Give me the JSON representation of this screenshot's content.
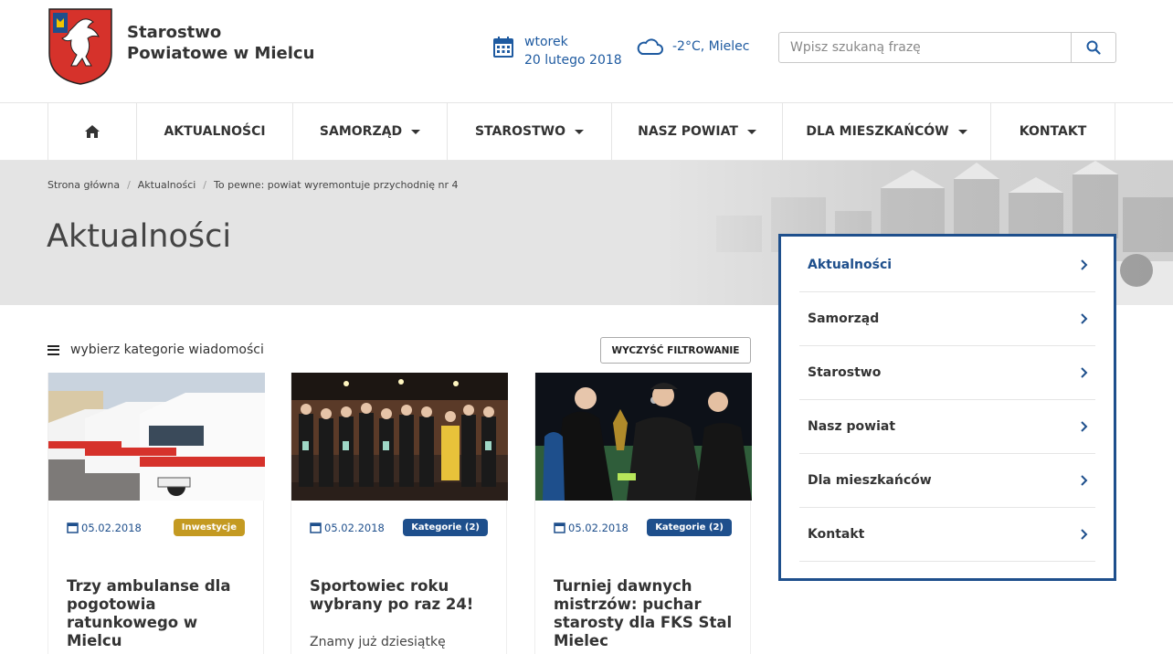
{
  "header": {
    "site_name_line1": "Starostwo",
    "site_name_line2": "Powiatowe w Mielcu",
    "date_day": "wtorek",
    "date_full": "20 lutego 2018",
    "weather": "-2°C, Mielec",
    "search_placeholder": "Wpisz szukaną frazę"
  },
  "nav": {
    "items": [
      {
        "label": "",
        "icon": "home-icon"
      },
      {
        "label": "AKTUALNOŚCI"
      },
      {
        "label": "SAMORZĄD"
      },
      {
        "label": "STAROSTWO"
      },
      {
        "label": "NASZ POWIAT"
      },
      {
        "label": "DLA MIESZKAŃCÓW"
      },
      {
        "label": "KONTAKT"
      }
    ]
  },
  "breadcrumb": [
    "Strona główna",
    "Aktualności",
    "To pewne: powiat wyremontuje przychodnię nr 4"
  ],
  "page_title": "Aktualności",
  "side_menu": [
    {
      "label": "Aktualności"
    },
    {
      "label": "Samorząd"
    },
    {
      "label": "Starostwo"
    },
    {
      "label": "Nasz powiat"
    },
    {
      "label": "Dla mieszkańców"
    },
    {
      "label": "Kontakt"
    }
  ],
  "filter": {
    "label": "wybierz kategorie wiadomości",
    "clear_button": "WYCZYŚĆ FILTROWANIE"
  },
  "cards": [
    {
      "date": "05.02.2018",
      "badge": "Inwestycje",
      "title": "Trzy ambulanse dla pogotowia ratunkowego w Mielcu",
      "excerpt": ""
    },
    {
      "date": "05.02.2018",
      "badge": "Kategorie (2)",
      "title": "Sportowiec roku wybrany po raz 24!",
      "excerpt": "Znamy już dziesiątkę"
    },
    {
      "date": "05.02.2018",
      "badge": "Kategorie (2)",
      "title": "Turniej dawnych mistrzów: puchar starosty dla FKS Stal Mielec",
      "excerpt": ""
    }
  ],
  "colors": {
    "primary": "#1e4f8c",
    "link": "#1e5aa0",
    "badge_gold": "#c49a22"
  }
}
